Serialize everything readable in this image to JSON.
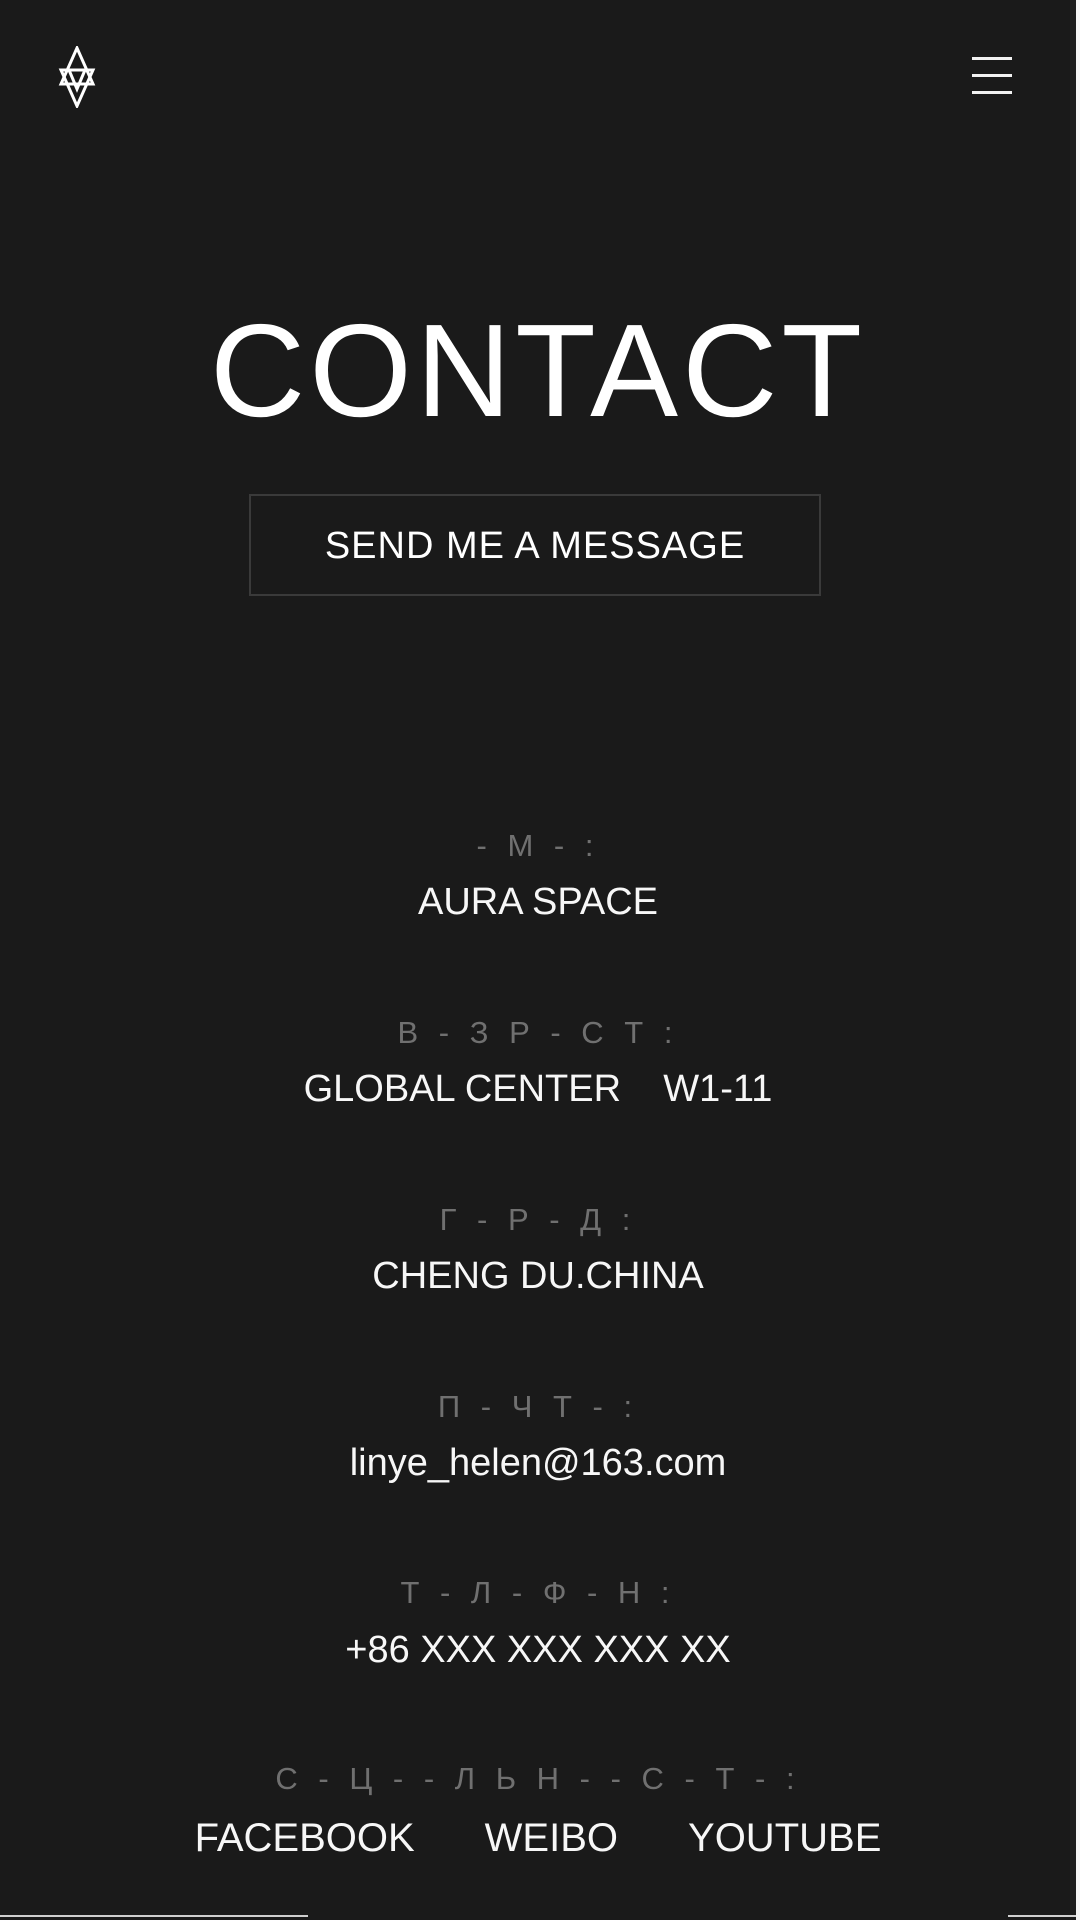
{
  "header": {
    "logo_icon": "logo-icon",
    "menu_icon": "hamburger-menu-icon"
  },
  "page": {
    "title": "CONTACT",
    "button_label": "SEND ME A MESSAGE"
  },
  "contact": {
    "name_label": "- М - :",
    "name_value": "AURA SPACE",
    "address_label": "В - З Р - С Т :",
    "address_value": "GLOBAL CENTER    W1-11",
    "city_label": "Г - Р - Д :",
    "city_value": "CHENG DU.CHINA",
    "email_label": "П - Ч Т - :",
    "email_value": "linye_helen@163.com",
    "phone_label": "Т - Л - Ф - Н :",
    "phone_value": "+86 XXX XXX XXX XX",
    "social_label": "С - Ц - - Л Ь Н - - С - Т - :",
    "social_links": [
      "FACEBOOK",
      "WEIBO",
      "YOUTUBE"
    ]
  },
  "colors": {
    "background": "#1a1a1a",
    "text": "#ffffff",
    "muted_label": "#707070",
    "button_border": "#3a3a3a"
  }
}
